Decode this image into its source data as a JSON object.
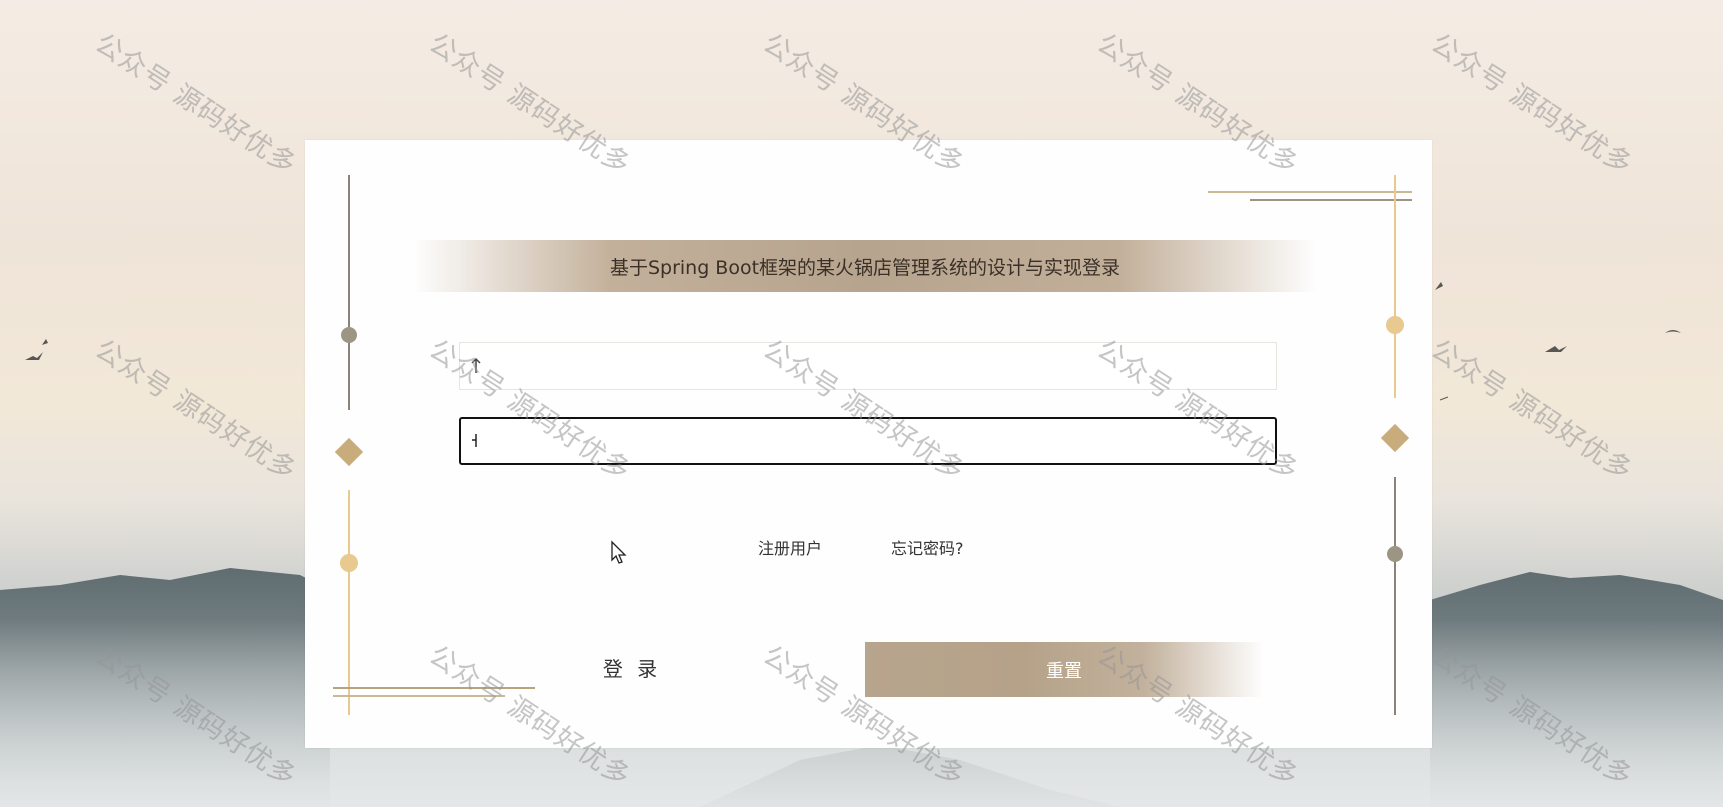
{
  "title": "基于Spring Boot框架的某火锅店管理系统的设计与实现登录",
  "form": {
    "username_value": "",
    "password_value": ""
  },
  "links": {
    "register": "注册用户",
    "forgot": "忘记密码?"
  },
  "buttons": {
    "login": "登 录",
    "reset": "重置"
  },
  "watermark": "公众号 源码好优多",
  "colors": {
    "accent": "#b7a48e",
    "gold": "#e8c98f",
    "diamond": "#c8ac7c",
    "line_gray": "#8a8478"
  },
  "icons": {
    "username": "user-icon",
    "password": "lock-icon",
    "pointer": "mouse-pointer-icon"
  }
}
